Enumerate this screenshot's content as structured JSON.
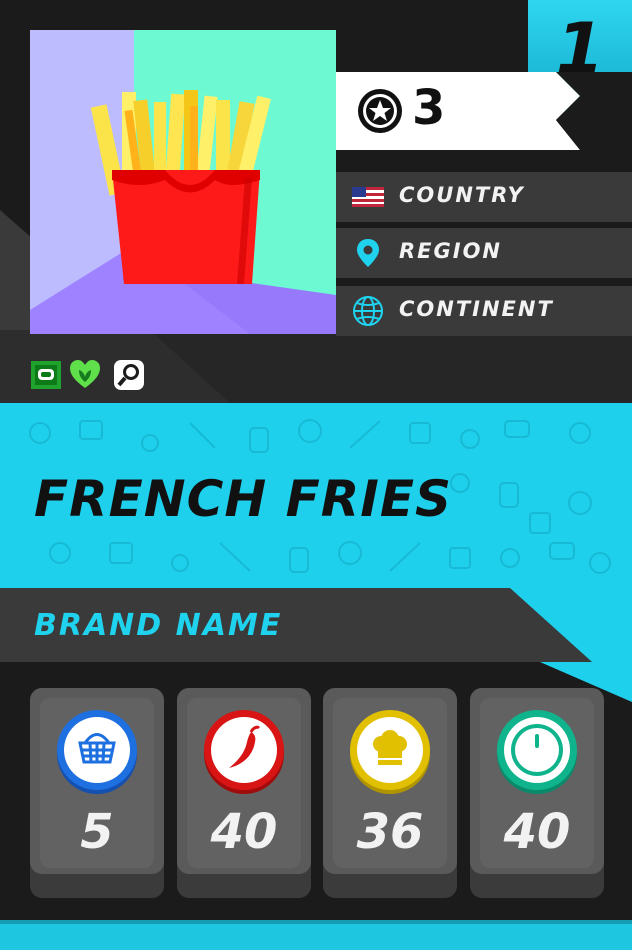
{
  "card": {
    "rank": "1",
    "rating": "3",
    "rating_icon": "star-circle-icon",
    "location": [
      {
        "icon": "us-flag-icon",
        "label": "COUNTRY"
      },
      {
        "icon": "map-pin-icon",
        "label": "REGION"
      },
      {
        "icon": "globe-icon",
        "label": "CONTINENT"
      }
    ],
    "badges": [
      "chat-icon",
      "vegan-heart-icon",
      "search-icon"
    ],
    "title": "FRENCH FRIES",
    "brand": "BRAND NAME",
    "stats": [
      {
        "icon": "basket-icon",
        "value": "5",
        "color": "#1e6fe0"
      },
      {
        "icon": "chili-icon",
        "value": "40",
        "color": "#d81414"
      },
      {
        "icon": "chef-hat-icon",
        "value": "36",
        "color": "#e0c000"
      },
      {
        "icon": "timer-icon",
        "value": "40",
        "color": "#0fb48c"
      }
    ]
  },
  "colors": {
    "accent": "#1fd2ee",
    "background": "#1b1b1b",
    "panel": "#3a3a3a"
  }
}
